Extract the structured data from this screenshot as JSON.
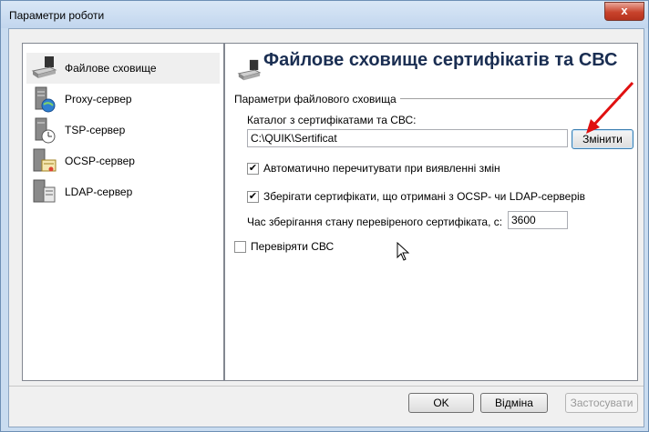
{
  "window": {
    "title": "Параметри роботи",
    "close": "x"
  },
  "nav": [
    {
      "label": "Файлове сховище",
      "icon": "storage-drive-icon"
    },
    {
      "label": "Proxy-сервер",
      "icon": "proxy-server-icon"
    },
    {
      "label": "TSP-сервер",
      "icon": "tsp-server-icon"
    },
    {
      "label": "OCSP-сервер",
      "icon": "ocsp-server-icon"
    },
    {
      "label": "LDAP-сервер",
      "icon": "ldap-server-icon"
    }
  ],
  "main": {
    "header": "Файлове сховище сертифікатів та СВС",
    "group": "Параметри файлового сховища",
    "dir_label": "Каталог з сертифікатами та СВС:",
    "dir_value": "C:\\QUIK\\Sertificat",
    "change_button": "Змінити",
    "auto_reread": {
      "label": "Автоматично перечитувати при виявленні змін",
      "checked": true
    },
    "save_certs": {
      "label": "Зберігати сертифікати, що отримані з OCSP- чи LDAP-серверів",
      "checked": true
    },
    "time_label": "Час зберігання стану перевіреного сертифіката, с:",
    "time_value": "3600",
    "verify_crl": {
      "label": "Перевіряти СВС",
      "checked": false
    }
  },
  "buttons": {
    "ok": "OK",
    "cancel": "Відміна",
    "apply": "Застосувати"
  },
  "check_glyph": "✔"
}
